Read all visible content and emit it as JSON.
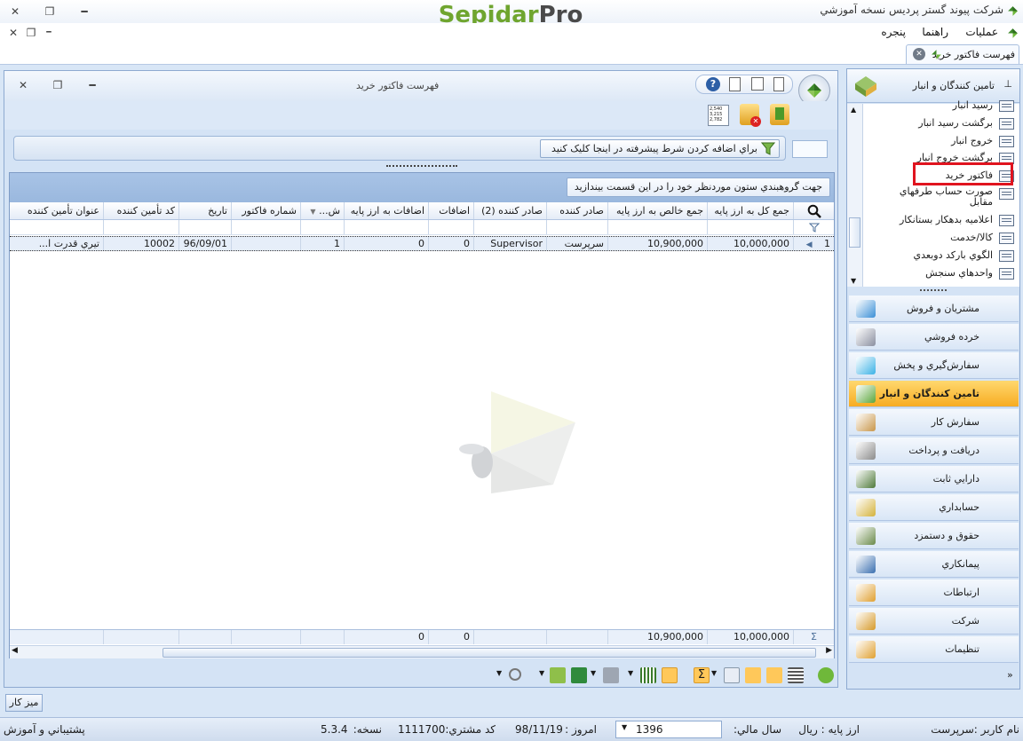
{
  "window": {
    "title": "شرکت پیوند گستر پردیس نسخه آموزشي",
    "logo_part1": "Sepidar",
    "logo_part2": "Pro",
    "minimize_glyph": "━",
    "restore_glyph": "❐",
    "close_glyph": "✕"
  },
  "menu": {
    "items": [
      "عمليات",
      "راهنما",
      "پنجره"
    ]
  },
  "tab": {
    "label": "فهرست فاکتور خريد"
  },
  "main": {
    "title": "فهرست فاکتور خريد",
    "filter_button": "براي اضافه کردن شرط پيشرفته در اينجا کليک کنيد",
    "group_hint": "جهت گروهبندي ستون موردنظر خود را در اين قسمت بيندازيد",
    "columns": [
      "جمع کل به ارز پايه",
      "جمع خالص به ارز پايه",
      "صادر کننده",
      "صادر کننده (2)",
      "اضافات",
      "اضافات به ارز پايه",
      "ش...",
      "شماره فاکتور",
      "تاريخ",
      "کد تأمين کننده",
      "عنوان تأمين کننده"
    ],
    "row": {
      "index": "1",
      "total": "10,000,000",
      "net": "10,900,000",
      "issuer": "سرپرست",
      "issuer2": "Supervisor",
      "additions": "0",
      "additions_base": "0",
      "sh": "1",
      "invoice_no": "",
      "date": "96/09/01",
      "supplier_code": "10002",
      "supplier_title": "تيري قدرت ا..."
    },
    "footer": {
      "total": "10,000,000",
      "net": "10,900,000",
      "additions": "0",
      "additions_base": "0"
    }
  },
  "nav": {
    "header": "تامين کنندگان و انبار",
    "items": [
      "رسيد انبار",
      "برگشت رسيد انبار",
      "خروج انبار",
      "برگشت خروج انبار",
      "فاکتور خريد",
      "صورت حساب طرفهاي مقابل",
      "اعلاميه بدهکار بستانکار",
      "کالا/خدمت",
      "الگوي بارکد دوبعدي",
      "واحدهاي سنجش"
    ],
    "modules": [
      {
        "label": "مشتريان و فروش",
        "color": "#3a8fd6"
      },
      {
        "label": "خرده فروشي",
        "color": "#8a8fa0"
      },
      {
        "label": "سفارش‌گيري و پخش",
        "color": "#3bb2e6"
      },
      {
        "label": "تامين کنندگان و انبار",
        "color": "#5aa63a"
      },
      {
        "label": "سفارش کار",
        "color": "#c8964a"
      },
      {
        "label": "دريافت و پرداخت",
        "color": "#8b8b8b"
      },
      {
        "label": "دارايي ثابت",
        "color": "#4f7a3a"
      },
      {
        "label": "حسابداري",
        "color": "#d4b23a"
      },
      {
        "label": "حقوق و دستمزد",
        "color": "#6a8a4a"
      },
      {
        "label": "پيمانکاري",
        "color": "#3a6fb0"
      },
      {
        "label": "ارتباطات",
        "color": "#e0a030"
      },
      {
        "label": "شرکت",
        "color": "#d69a2a"
      },
      {
        "label": "تنظيمات",
        "color": "#e0a030"
      }
    ]
  },
  "desk_tab": "ميز کار",
  "status": {
    "user_label": "نام کاربر :",
    "user": "سرپرست",
    "currency_label": "ارز پايه :",
    "currency": "ريال",
    "fiscal_label": "سال مالي:",
    "fiscal_year": "1396",
    "today_label": "امروز :",
    "today": "98/11/19",
    "customer_label": "کد مشتري:",
    "customer": "1111700",
    "version_label": "نسخه:",
    "version": "5.3.4",
    "support": "پشتيباني و آموزش"
  }
}
